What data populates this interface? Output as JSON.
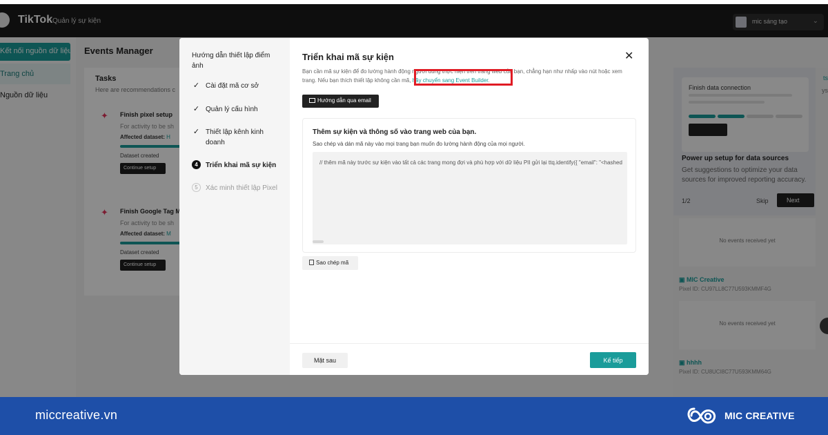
{
  "topbar": {
    "brand": "TikTok",
    "brand_sub": "Quản lý sự kiện",
    "account_name": "mic sáng tạo",
    "account_chevron": "⌄"
  },
  "sidebar": {
    "connect_button": "Kết nối nguồn dữ liệu",
    "items": [
      {
        "label": "Trang chủ"
      },
      {
        "label": "Nguồn dữ liệu"
      }
    ]
  },
  "main": {
    "title": "Events Manager",
    "tasks": {
      "title": "Tasks",
      "subtitle": "Here are recommendations c",
      "items": [
        {
          "title": "Finish pixel setup",
          "desc": "For activity to be sh",
          "affected_label": "Affected dataset:",
          "affected_value": "H",
          "status": "Dataset created",
          "button": "Continue setup"
        },
        {
          "title": "Finish Google Tag M",
          "desc": "For activity to be sh",
          "affected_label": "Affected dataset:",
          "affected_value": "M",
          "status": "Dataset created",
          "button": "Continue setup"
        }
      ]
    }
  },
  "right_panel": {
    "corner_link": "ts",
    "corner_text": "ys",
    "onboarding": {
      "card_title": "Finish data connection",
      "heading": "Power up setup for data sources",
      "body": "Get suggestions to optimize your data sources for improved reporting accuracy.",
      "page": "1/2",
      "skip": "Skip",
      "next": "Next"
    },
    "pixels": [
      {
        "no_events": "No events received yet",
        "name": "MIC Creative",
        "id": "Pixel ID: CU97LL8C77U593KMMF4G"
      },
      {
        "no_events": "No events received yet",
        "name": "hhhh",
        "id": "Pixel ID: CU8UCI8C77U593KMM64G"
      }
    ]
  },
  "modal": {
    "steps_title": "Hướng dẫn thiết lập điểm ảnh",
    "steps": [
      {
        "number": "✓",
        "label": "Cài đặt mã cơ sở",
        "state": "done"
      },
      {
        "number": "✓",
        "label": "Quản lý cấu hình",
        "state": "done"
      },
      {
        "number": "✓",
        "label": "Thiết lập kênh kinh doanh",
        "state": "done"
      },
      {
        "number": "4",
        "label": "Triển khai mã sự kiện",
        "state": "active"
      },
      {
        "number": "5",
        "label": "Xác minh thiết lập Pixel",
        "state": "pending"
      }
    ],
    "title": "Triển khai mã sự kiện",
    "close": "✕",
    "description_before": "Bạn cần mã sự kiện để đo lường hành động người dùng thực hiện trên trang web của bạn, chẳng hạn như nhấp vào nút hoặc xem trang. Nếu bạn thích thiết lập không cần mã,",
    "description_link": "hãy chuyển sang Event Builder",
    "description_after": ".",
    "email_button": "Hướng dẫn qua email",
    "code_card": {
      "title": "Thêm sự kiện và thông số vào trang web của bạn.",
      "subtitle": "Sao chép và dán mã này vào mọi trang bạn muốn đo lường hành động của mọi người.",
      "code": "// thêm mã này trước sự kiện vào tất cả các trang mong đợi và phù hợp với dữ liệu PII gửi lại ttq.identify({ \"email\": \"<hashed"
    },
    "copy_button": "Sao chép mã",
    "back_button": "Mặt sau",
    "next_button": "Kế tiếp"
  },
  "banner": {
    "site": "miccreative.vn",
    "brand": "MIC CREATIVE"
  },
  "colors": {
    "accent": "#1a9c9a",
    "highlight": "#e01b24",
    "banner": "#1e4fa8"
  }
}
